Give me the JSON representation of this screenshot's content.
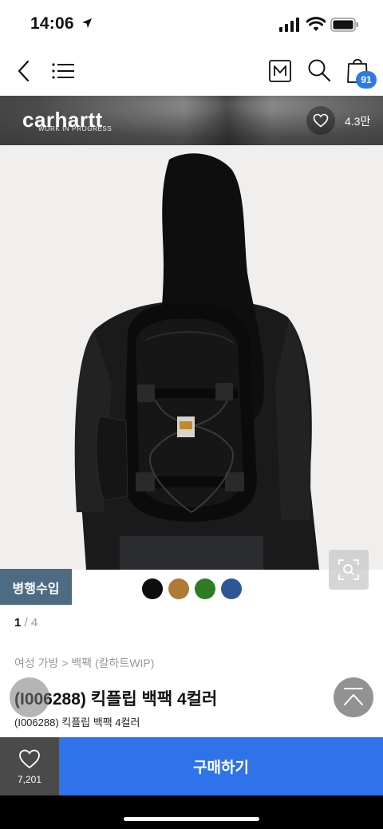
{
  "status_bar": {
    "time": "14:06"
  },
  "nav": {
    "cart_count": "91"
  },
  "brand": {
    "name": "carhartt",
    "tagline": "WORK IN PROGRESS",
    "likes": "4.3만"
  },
  "product": {
    "import_tag": "병행수입",
    "page_current": "1",
    "page_total": "4",
    "breadcrumb": "여성 가방 > 백팩 (칼하트WIP)",
    "title": "(I006288) 킥플립 백팩 4컬러",
    "subtitle": "(I006288) 킥플립 백팩 4컬러",
    "swatches": [
      {
        "name": "black",
        "color": "#0d0d0d"
      },
      {
        "name": "brown",
        "color": "#b07a35"
      },
      {
        "name": "green",
        "color": "#2f7a25"
      },
      {
        "name": "blue",
        "color": "#2e5595"
      }
    ]
  },
  "bottom": {
    "like_count": "7,201",
    "buy_label": "구매하기"
  },
  "colors": {
    "buy": "#2f73ea",
    "badge": "#2c7be5",
    "import_tag": "#4d6b82"
  }
}
